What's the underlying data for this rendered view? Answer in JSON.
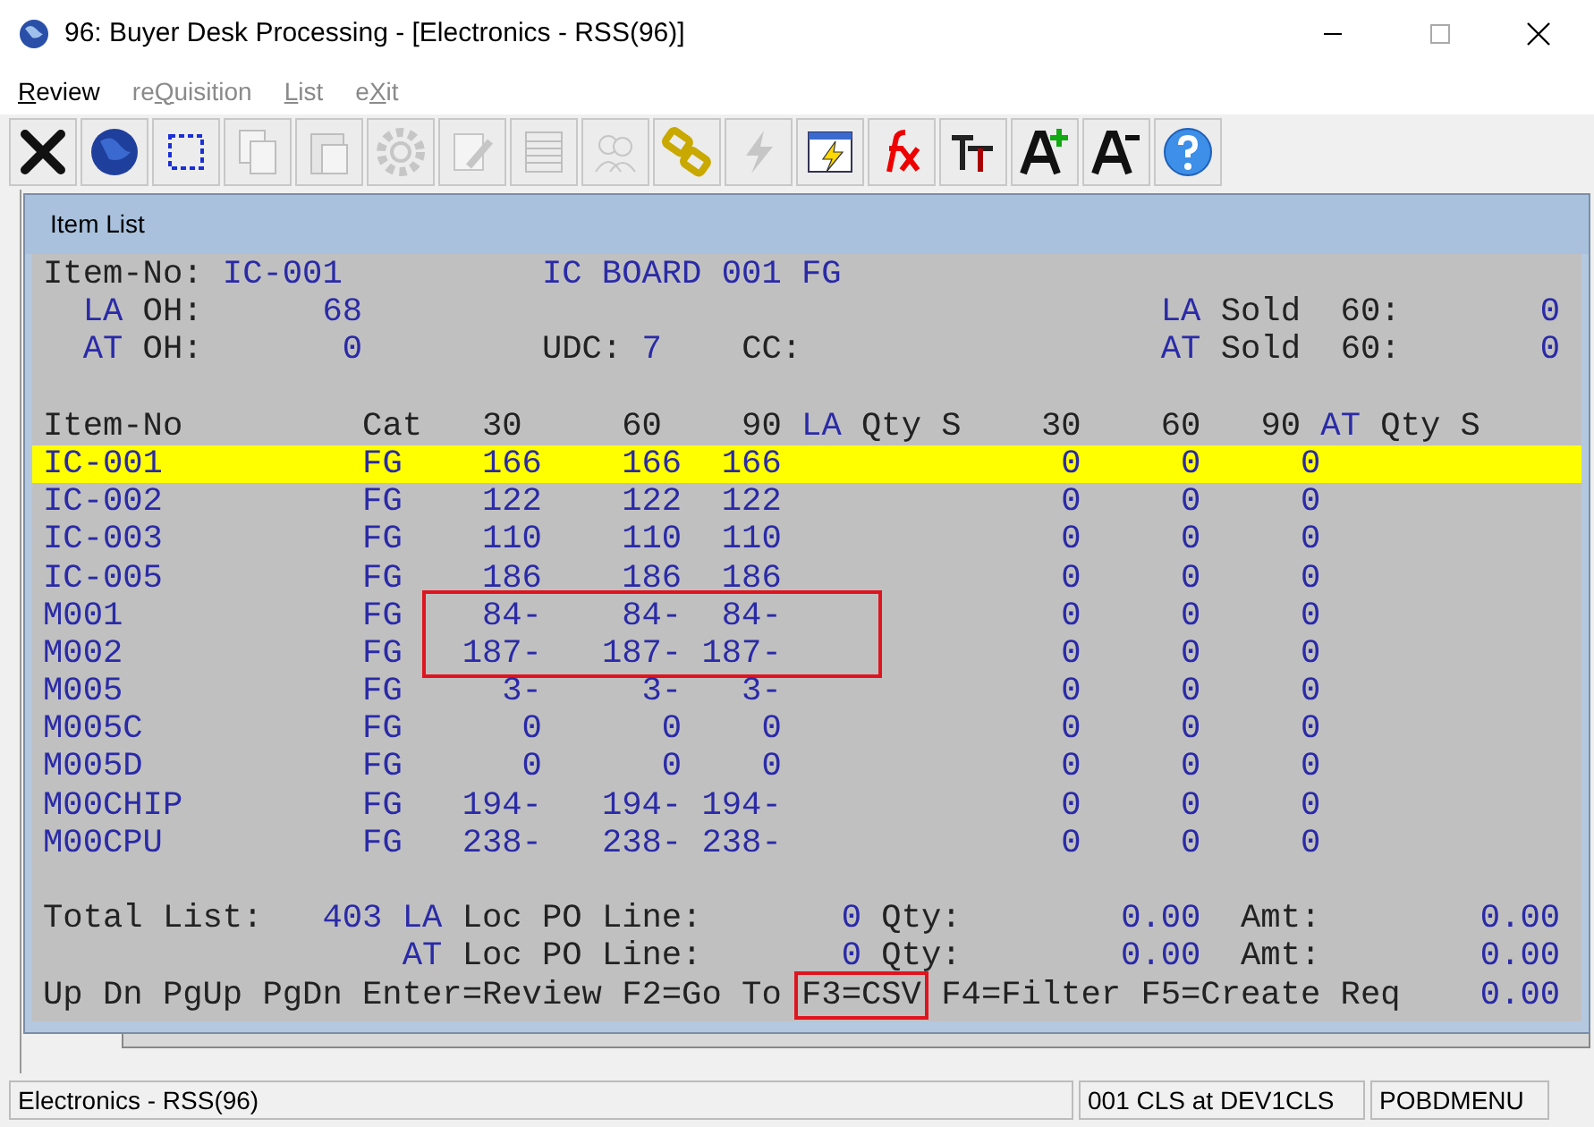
{
  "window": {
    "title": "96: Buyer Desk Processing - [Electronics - RSS(96)]"
  },
  "menu": [
    {
      "key": "R",
      "suffix": "eview",
      "disabled": false
    },
    {
      "prefix": "re",
      "key": "Q",
      "suffix": "uisition",
      "disabled": true
    },
    {
      "key": "L",
      "suffix": "ist",
      "disabled": true
    },
    {
      "prefix": "e",
      "key": "X",
      "suffix": "it",
      "disabled": true
    }
  ],
  "toolbar": [
    {
      "kind": "close",
      "disabled": false
    },
    {
      "kind": "globe",
      "disabled": false
    },
    {
      "kind": "select",
      "disabled": false
    },
    {
      "kind": "copy",
      "disabled": true
    },
    {
      "kind": "paste",
      "disabled": true
    },
    {
      "kind": "gear",
      "disabled": true
    },
    {
      "kind": "edit",
      "disabled": true
    },
    {
      "kind": "table",
      "disabled": true
    },
    {
      "kind": "people",
      "disabled": true
    },
    {
      "kind": "chain",
      "disabled": false
    },
    {
      "kind": "lightning",
      "disabled": true
    },
    {
      "kind": "flash",
      "disabled": false
    },
    {
      "kind": "formula",
      "disabled": false
    },
    {
      "kind": "font",
      "disabled": false
    },
    {
      "kind": "grow",
      "disabled": false
    },
    {
      "kind": "shrink",
      "disabled": false
    },
    {
      "kind": "help",
      "disabled": false
    }
  ],
  "item_list": {
    "title": "Item List",
    "header": {
      "item_no_label": "Item-No:",
      "item_no": "IC-001",
      "description": "IC BOARD 001 FG",
      "udc_label": "UDC:",
      "udc": "7",
      "cc_label": "CC:",
      "locations": [
        {
          "code": "LA",
          "oh_label": "OH:",
          "oh": "68",
          "sold_code": "LA",
          "sold_label": "Sold",
          "sold_period": "60:",
          "sold": "0"
        },
        {
          "code": "AT",
          "oh_label": "OH:",
          "oh": "0",
          "sold_code": "AT",
          "sold_label": "Sold",
          "sold_period": "60:",
          "sold": "0"
        }
      ]
    },
    "columns": [
      {
        "text": "Item-No",
        "kind": "label"
      },
      {
        "text": "Cat",
        "kind": "label"
      },
      {
        "text": "30",
        "kind": "label"
      },
      {
        "text": "60",
        "kind": "label"
      },
      {
        "text": "90",
        "kind": "label"
      },
      {
        "text": "LA",
        "kind": "location"
      },
      {
        "text": "Qty S",
        "kind": "label"
      },
      {
        "text": "30",
        "kind": "label"
      },
      {
        "text": "60",
        "kind": "label"
      },
      {
        "text": "90",
        "kind": "label"
      },
      {
        "text": "AT",
        "kind": "location"
      },
      {
        "text": "Qty S",
        "kind": "label"
      }
    ],
    "rows": [
      {
        "item": "IC-001",
        "cat": "FG",
        "q30": "166",
        "q60": "166",
        "q90": "166",
        "la30": "0",
        "la60": "0",
        "la90": "0",
        "selected": true,
        "outlined": false
      },
      {
        "item": "IC-002",
        "cat": "FG",
        "q30": "122",
        "q60": "122",
        "q90": "122",
        "la30": "0",
        "la60": "0",
        "la90": "0",
        "selected": false,
        "outlined": false
      },
      {
        "item": "IC-003",
        "cat": "FG",
        "q30": "110",
        "q60": "110",
        "q90": "110",
        "la30": "0",
        "la60": "0",
        "la90": "0",
        "selected": false,
        "outlined": false
      },
      {
        "item": "IC-005",
        "cat": "FG",
        "q30": "186",
        "q60": "186",
        "q90": "186",
        "la30": "0",
        "la60": "0",
        "la90": "0",
        "selected": false,
        "outlined": false
      },
      {
        "item": "M001",
        "cat": "FG",
        "q30": "84-",
        "q60": "84-",
        "q90": "84-",
        "la30": "0",
        "la60": "0",
        "la90": "0",
        "selected": false,
        "outlined": true
      },
      {
        "item": "M002",
        "cat": "FG",
        "q30": "187-",
        "q60": "187-",
        "q90": "187-",
        "la30": "0",
        "la60": "0",
        "la90": "0",
        "selected": false,
        "outlined": true
      },
      {
        "item": "M005",
        "cat": "FG",
        "q30": "3-",
        "q60": "3-",
        "q90": "3-",
        "la30": "0",
        "la60": "0",
        "la90": "0",
        "selected": false,
        "outlined": false
      },
      {
        "item": "M005C",
        "cat": "FG",
        "q30": "0",
        "q60": "0",
        "q90": "0",
        "la30": "0",
        "la60": "0",
        "la90": "0",
        "selected": false,
        "outlined": false
      },
      {
        "item": "M005D",
        "cat": "FG",
        "q30": "0",
        "q60": "0",
        "q90": "0",
        "la30": "0",
        "la60": "0",
        "la90": "0",
        "selected": false,
        "outlined": false
      },
      {
        "item": "M00CHIP",
        "cat": "FG",
        "q30": "194-",
        "q60": "194-",
        "q90": "194-",
        "la30": "0",
        "la60": "0",
        "la90": "0",
        "selected": false,
        "outlined": false
      },
      {
        "item": "M00CPU",
        "cat": "FG",
        "q30": "238-",
        "q60": "238-",
        "q90": "238-",
        "la30": "0",
        "la60": "0",
        "la90": "0",
        "selected": false,
        "outlined": false
      }
    ],
    "totals": {
      "label": "Total List:",
      "count": "403",
      "lines": [
        {
          "code": "LA",
          "label": "Loc PO Line:",
          "lines": "0",
          "qty_label": "Qty:",
          "qty": "0.00",
          "amt_label": "Amt:",
          "amt": "0.00"
        },
        {
          "code": "AT",
          "label": "Loc PO Line:",
          "lines": "0",
          "qty_label": "Qty:",
          "qty": "0.00",
          "amt_label": "Amt:",
          "amt": "0.00"
        }
      ]
    },
    "key_hints": [
      {
        "text": "Up Dn PgUp PgDn Enter=Review F2=Go To",
        "outlined": false
      },
      {
        "text": "F3=CSV",
        "outlined": true
      },
      {
        "text": "F4=Filter F5=Create Req",
        "outlined": false
      }
    ],
    "footer_value": "0.00"
  },
  "status_bar": [
    {
      "text": "Electronics - RSS(96)"
    },
    {
      "text": "001 CLS at DEV1CLS"
    },
    {
      "text": "POBDMENU"
    }
  ]
}
